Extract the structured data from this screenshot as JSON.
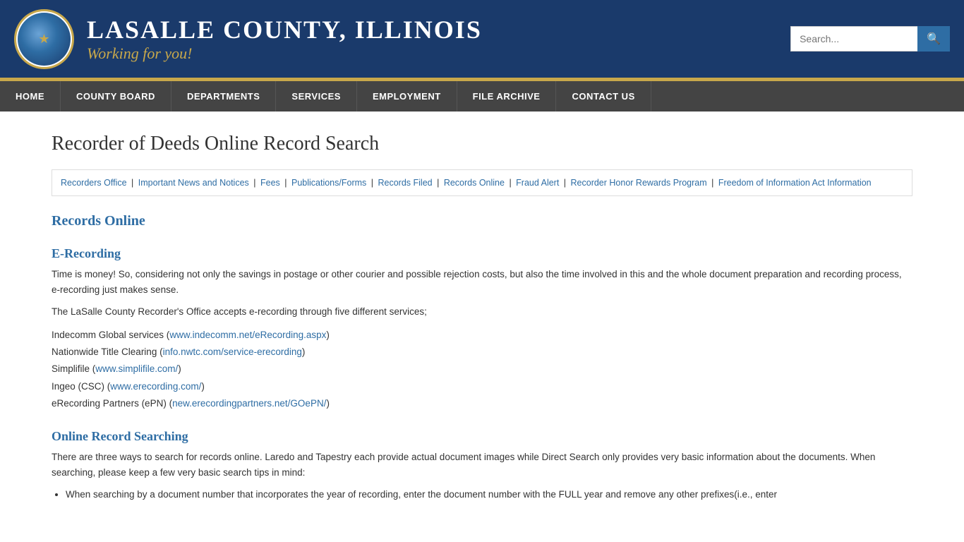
{
  "header": {
    "county_name": "LASALLE COUNTY, ILLINOIS",
    "tagline": "Working for you!",
    "search_placeholder": "Search..."
  },
  "nav": {
    "items": [
      {
        "label": "HOME"
      },
      {
        "label": "COUNTY BOARD"
      },
      {
        "label": "DEPARTMENTS"
      },
      {
        "label": "SERVICES"
      },
      {
        "label": "EMPLOYMENT"
      },
      {
        "label": "FILE ARCHIVE"
      },
      {
        "label": "CONTACT US"
      }
    ]
  },
  "page": {
    "title": "Recorder of Deeds Online Record Search",
    "breadcrumbs": [
      {
        "label": "Recorders Office"
      },
      {
        "label": "Important News and Notices"
      },
      {
        "label": "Fees"
      },
      {
        "label": "Publications/Forms"
      },
      {
        "label": "Records Filed"
      },
      {
        "label": "Records Online"
      },
      {
        "label": "Fraud Alert"
      },
      {
        "label": "Recorder Honor Rewards Program"
      },
      {
        "label": "Freedom of Information Act Information"
      }
    ],
    "section_heading": "Records Online",
    "erecording": {
      "heading": "E-Recording",
      "para1": "Time is money! So, considering not only the savings in postage or other courier and possible rejection costs, but also the time involved in this and the whole document preparation and recording process, e-recording just makes sense.",
      "para2": "The LaSalle County Recorder's Office accepts e-recording through five different services;",
      "services": [
        {
          "label": "Indecomm Global services (",
          "link_text": "www.indecomm.net/eRecording.aspx",
          "suffix": ")"
        },
        {
          "label": "Nationwide Title Clearing (",
          "link_text": "info.nwtc.com/service-erecording",
          "suffix": ")"
        },
        {
          "label": "Simplifile (",
          "link_text": "www.simplifile.com/",
          "suffix": ")"
        },
        {
          "label": "Ingeo (CSC) (",
          "link_text": "www.erecording.com/",
          "suffix": ")"
        },
        {
          "label": "eRecording Partners (ePN) (",
          "link_text": "new.erecordingpartners.net/GOePN/",
          "suffix": ")"
        }
      ]
    },
    "online_search": {
      "heading": "Online Record Searching",
      "para1": "There are three ways to search for records online. Laredo and Tapestry each provide actual document images while Direct Search only provides very basic information about the documents. When searching, please keep a few very basic search tips in mind:",
      "bullet": "When searching by a document number that incorporates the year of recording, enter the document number with the FULL year and remove any other prefixes(i.e., enter"
    }
  }
}
